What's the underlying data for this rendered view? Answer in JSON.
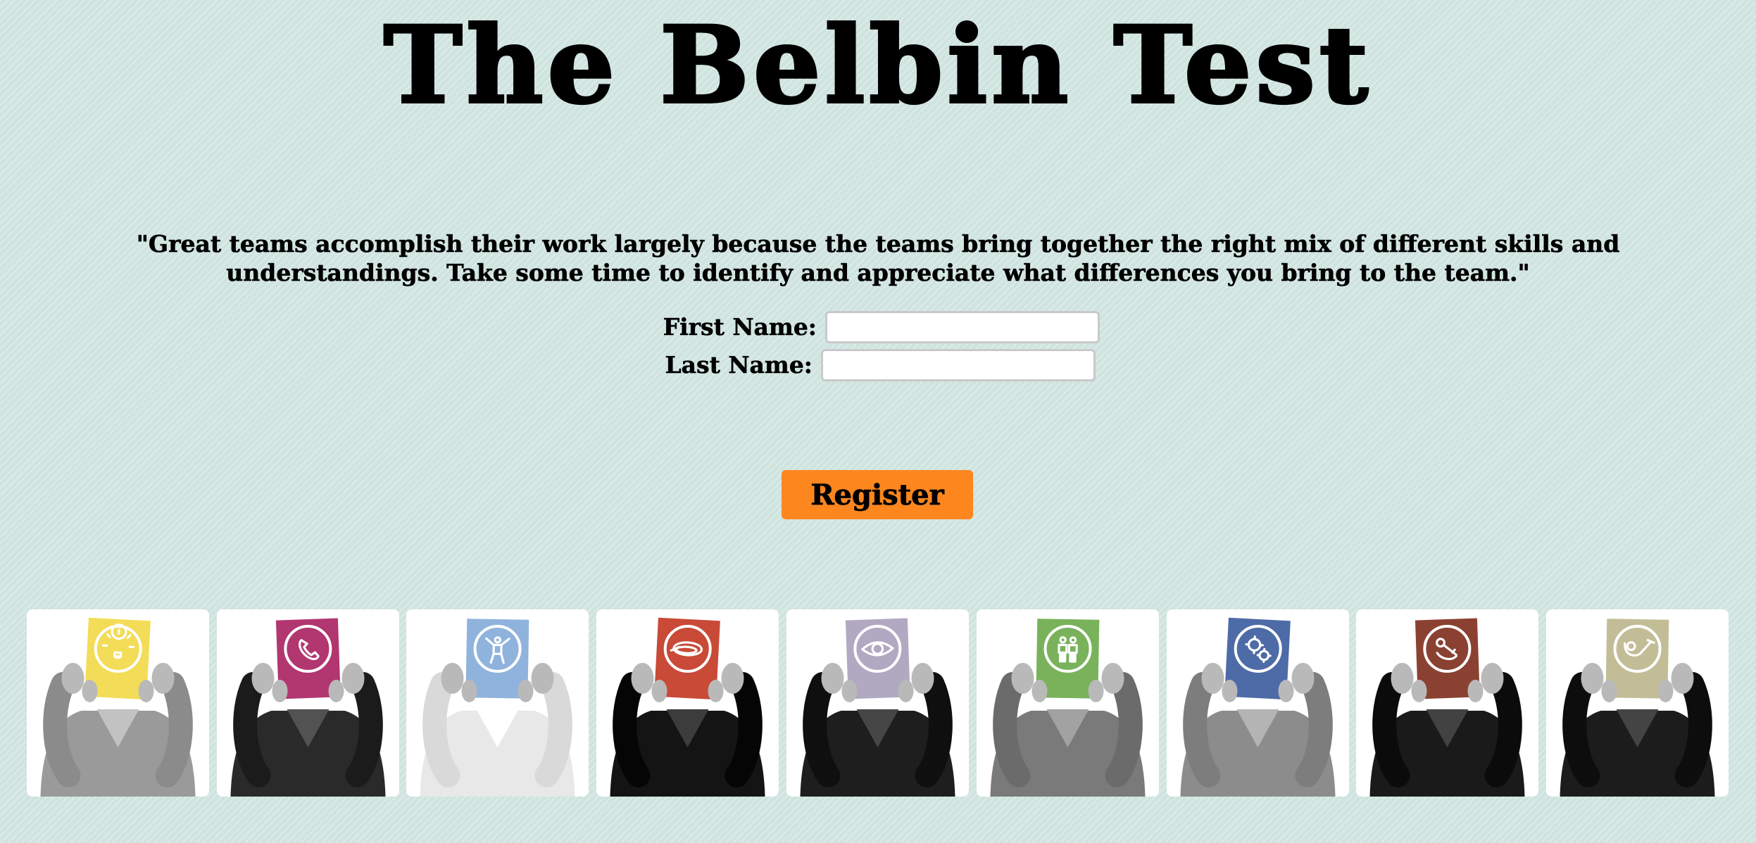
{
  "page": {
    "title": "The Belbin Test",
    "quote": "\"Great teams accomplish their work largely because the teams bring together the right mix of different skills and understandings. Take some time to identify and appreciate what differences you bring to the team.\""
  },
  "form": {
    "first_name_label": "First Name:",
    "first_name_value": "",
    "last_name_label": "Last Name:",
    "last_name_value": "",
    "register_label": "Register"
  },
  "colors": {
    "background": "#cfe3df",
    "register_button": "#fd861f"
  },
  "role_cards": [
    {
      "icon": "lightbulb-icon",
      "color": "#f3dc57",
      "clothing": "#9a9a9a"
    },
    {
      "icon": "phone-icon",
      "color": "#b2366f",
      "clothing": "#2a2a2a"
    },
    {
      "icon": "person-arms-up-icon",
      "color": "#8fb3dc",
      "clothing": "#e8e8e8"
    },
    {
      "icon": "loop-icon",
      "color": "#c84a37",
      "clothing": "#141414"
    },
    {
      "icon": "eye-icon",
      "color": "#b1a9c1",
      "clothing": "#1e1e1e"
    },
    {
      "icon": "two-people-icon",
      "color": "#79b25b",
      "clothing": "#7a7a7a"
    },
    {
      "icon": "gears-icon",
      "color": "#4d6ba6",
      "clothing": "#8c8c8c"
    },
    {
      "icon": "hand-key-icon",
      "color": "#8b4131",
      "clothing": "#1a1a1a"
    },
    {
      "icon": "pipe-icon",
      "color": "#c3bd97",
      "clothing": "#1c1c1c"
    }
  ]
}
